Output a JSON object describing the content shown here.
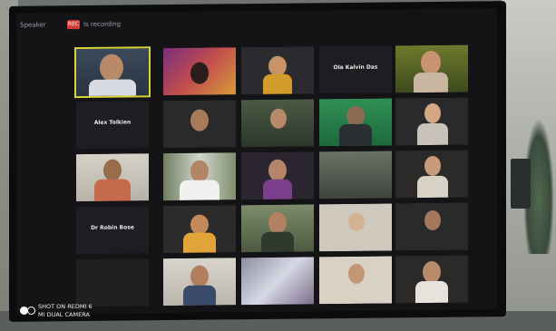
{
  "caption": {
    "line1": "SHOT ON REDMI 6",
    "line2": "MI DUAL CAMERA"
  },
  "toolbar": {
    "view_label": "Speaker",
    "rec_label": "REC",
    "meeting_label": "Is recording"
  },
  "participants": [
    {
      "label": "",
      "kind": "video"
    },
    {
      "label": "",
      "kind": "video"
    },
    {
      "label": "",
      "kind": "video"
    },
    {
      "label": "Ola Kalvin Das",
      "kind": "name"
    },
    {
      "label": "",
      "kind": "video"
    },
    {
      "label": "Alex Tolkien",
      "kind": "name"
    },
    {
      "label": "",
      "kind": "video"
    },
    {
      "label": "",
      "kind": "video"
    },
    {
      "label": "",
      "kind": "video"
    },
    {
      "label": "",
      "kind": "video"
    },
    {
      "label": "",
      "kind": "video"
    },
    {
      "label": "",
      "kind": "video"
    },
    {
      "label": "",
      "kind": "video"
    },
    {
      "label": "",
      "kind": "video"
    },
    {
      "label": "",
      "kind": "video"
    },
    {
      "label": "Dr Robin Bose",
      "kind": "name"
    },
    {
      "label": "",
      "kind": "video"
    },
    {
      "label": "",
      "kind": "video"
    },
    {
      "label": "",
      "kind": "video"
    },
    {
      "label": "",
      "kind": "video"
    },
    {
      "label": "",
      "kind": "video"
    },
    {
      "label": "",
      "kind": "video"
    },
    {
      "label": "",
      "kind": "video"
    },
    {
      "label": "",
      "kind": "video"
    },
    {
      "label": "",
      "kind": "video"
    }
  ]
}
